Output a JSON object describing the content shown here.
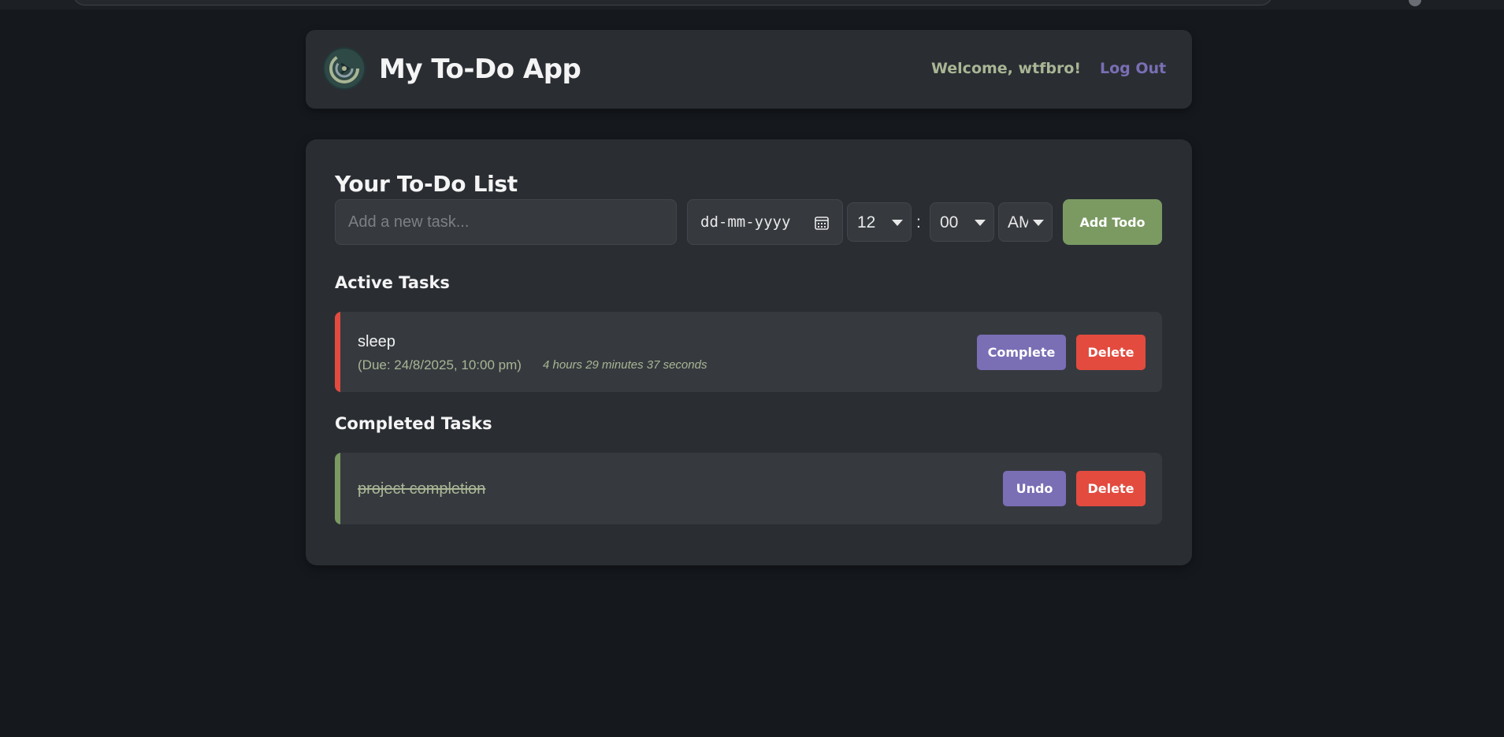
{
  "header": {
    "title": "My To-Do App",
    "welcome": "Welcome, wtfbro!",
    "logout": "Log Out",
    "logo_icon": "app-logo-icon"
  },
  "main": {
    "title": "Your To-Do List",
    "task_input_placeholder": "Add a new task...",
    "task_input_value": "",
    "date_placeholder": "dd-mm-yyyy",
    "hour": "12",
    "time_separator": ":",
    "minute": "00",
    "ampm": "AM",
    "add_button": "Add Todo"
  },
  "active_section": {
    "title": "Active Tasks",
    "tasks": [
      {
        "name": "sleep",
        "due": "(Due: 24/8/2025, 10:00 pm)",
        "countdown": "4 hours 29 minutes 37 seconds",
        "complete_label": "Complete",
        "delete_label": "Delete"
      }
    ]
  },
  "completed_section": {
    "title": "Completed Tasks",
    "tasks": [
      {
        "name": "project completion",
        "undo_label": "Undo",
        "delete_label": "Delete"
      }
    ]
  },
  "colors": {
    "accent_purple": "#7a6eb5",
    "accent_green": "#7a9a62",
    "danger_red": "#e34b3f",
    "muted_green_text": "#a9b594",
    "background": "#15181d",
    "card": "#2a2e33"
  }
}
